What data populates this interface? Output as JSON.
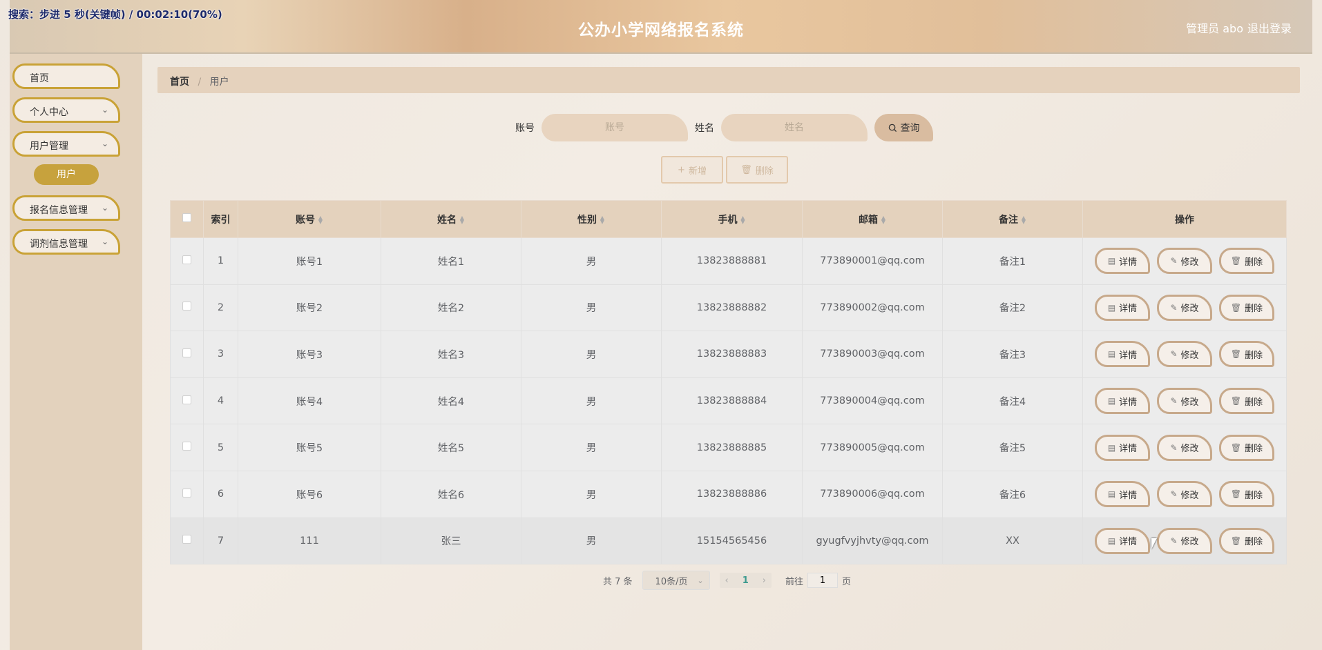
{
  "overlay": {
    "recording_text": "搜索：步进 5 秒(关键帧) / 00:02:10(70%)"
  },
  "header": {
    "title": "公办小学网络报名系统",
    "admin": "管理员 abo",
    "logout": "退出登录"
  },
  "sidebar": {
    "items": [
      {
        "label": "首页",
        "has_chevron": false
      },
      {
        "label": "个人中心",
        "has_chevron": true
      },
      {
        "label": "用户管理",
        "has_chevron": true
      },
      {
        "label": "报名信息管理",
        "has_chevron": true
      },
      {
        "label": "调剂信息管理",
        "has_chevron": true
      }
    ],
    "sub_active": "用户",
    "chevron": "⌄"
  },
  "breadcrumb": {
    "home": "首页",
    "separator": "/",
    "current": "用户"
  },
  "search": {
    "account_label": "账号",
    "account_placeholder": "账号",
    "name_label": "姓名",
    "name_placeholder": "姓名",
    "query_label": "查询",
    "query_icon": "search-icon"
  },
  "actions": {
    "add_label": "新增",
    "delete_label": "删除"
  },
  "table": {
    "headers": [
      "索引",
      "账号",
      "姓名",
      "性别",
      "手机",
      "邮箱",
      "备注",
      "操作"
    ],
    "rows": [
      {
        "index": "1",
        "account": "账号1",
        "name": "姓名1",
        "gender": "男",
        "phone": "13823888881",
        "email": "773890001@qq.com",
        "note": "备注1"
      },
      {
        "index": "2",
        "account": "账号2",
        "name": "姓名2",
        "gender": "男",
        "phone": "13823888882",
        "email": "773890002@qq.com",
        "note": "备注2"
      },
      {
        "index": "3",
        "account": "账号3",
        "name": "姓名3",
        "gender": "男",
        "phone": "13823888883",
        "email": "773890003@qq.com",
        "note": "备注3"
      },
      {
        "index": "4",
        "account": "账号4",
        "name": "姓名4",
        "gender": "男",
        "phone": "13823888884",
        "email": "773890004@qq.com",
        "note": "备注4"
      },
      {
        "index": "5",
        "account": "账号5",
        "name": "姓名5",
        "gender": "男",
        "phone": "13823888885",
        "email": "773890005@qq.com",
        "note": "备注5"
      },
      {
        "index": "6",
        "account": "账号6",
        "name": "姓名6",
        "gender": "男",
        "phone": "13823888886",
        "email": "773890006@qq.com",
        "note": "备注6"
      },
      {
        "index": "7",
        "account": "111",
        "name": "张三",
        "gender": "男",
        "phone": "15154565456",
        "email": "gyugfvyjhvty@qq.com",
        "note": "XX"
      }
    ],
    "op_labels": {
      "detail": "详情",
      "edit": "修改",
      "delete": "删除"
    }
  },
  "pagination": {
    "total": "共 7 条",
    "page_size": "10条/页",
    "current_page": "1",
    "goto_prefix": "前往",
    "goto_value": "1",
    "goto_suffix": "页"
  }
}
